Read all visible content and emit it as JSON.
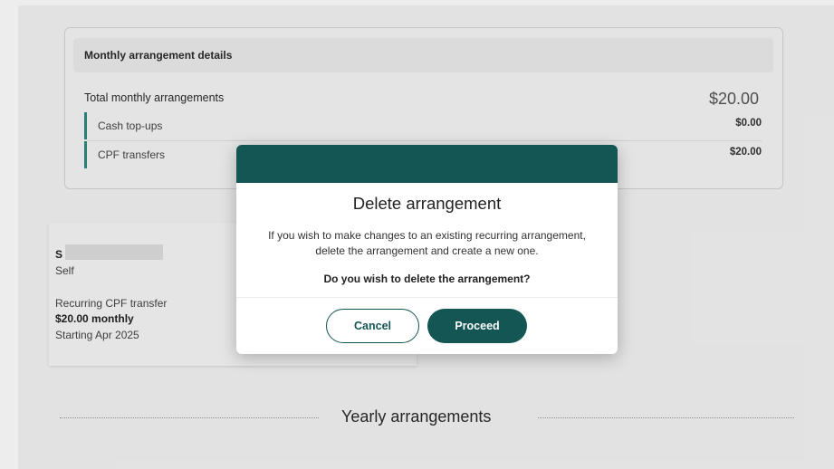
{
  "monthly": {
    "header": "Monthly arrangement details",
    "total_label": "Total monthly arrangements",
    "total_value": "$20.00",
    "rows": [
      {
        "label": "Cash top-ups",
        "value": "$0.00"
      },
      {
        "label": "CPF transfers",
        "value": "$20.00"
      }
    ]
  },
  "recipient": {
    "initial": "S",
    "relation": "Self",
    "type": "Recurring CPF transfer",
    "amount": "$20.00 monthly",
    "start": "Starting Apr 2025"
  },
  "yearly_title": "Yearly arrangements",
  "modal": {
    "title": "Delete arrangement",
    "message_line1": "If you wish to make changes to an existing recurring arrangement,",
    "message_line2": "delete the arrangement and create a new one.",
    "question": "Do you wish to delete the arrangement?",
    "cancel_label": "Cancel",
    "proceed_label": "Proceed"
  },
  "colors": {
    "brand": "#135654",
    "accent_bar": "#2e8a7e"
  }
}
